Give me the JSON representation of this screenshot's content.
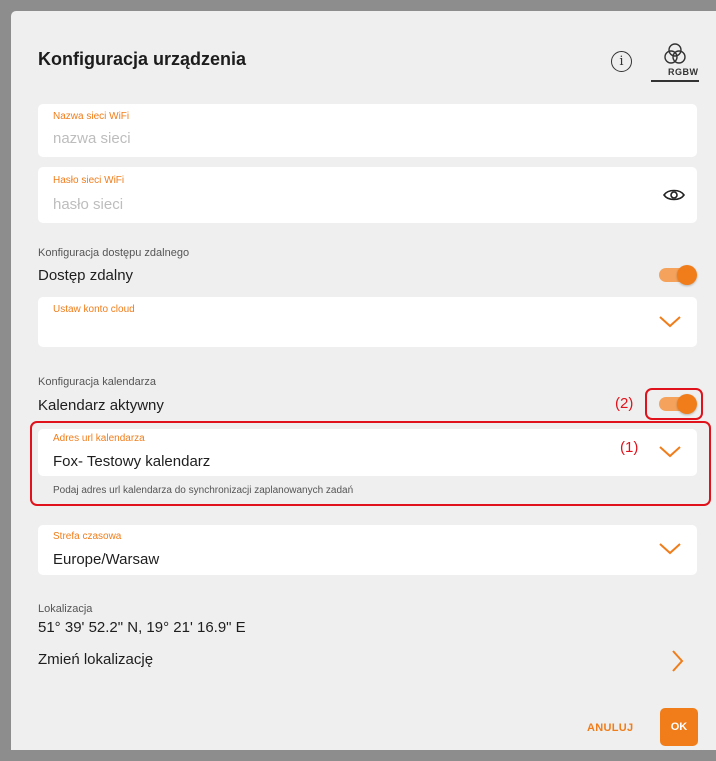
{
  "header": {
    "title": "Konfiguracja urządzenia",
    "info_icon_glyph": "i",
    "mode_label": "RGBW"
  },
  "wifi": {
    "network": {
      "label": "Nazwa sieci WiFi",
      "placeholder": "nazwa sieci"
    },
    "password": {
      "label": "Hasło sieci WiFi",
      "placeholder": "hasło sieci"
    }
  },
  "remote": {
    "caption": "Konfiguracja dostępu zdalnego",
    "title": "Dostęp zdalny",
    "enabled": true,
    "cloud_account": {
      "label": "Ustaw konto cloud",
      "value": ""
    }
  },
  "calendar": {
    "caption": "Konfiguracja kalendarza",
    "title": "Kalendarz aktywny",
    "enabled": true,
    "url": {
      "label": "Adres url kalendarza",
      "value": "Fox- Testowy kalendarz"
    },
    "hint": "Podaj adres url kalendarza do synchronizacji zaplanowanych zadań"
  },
  "annotations": {
    "one": "(1)",
    "two": "(2)"
  },
  "timezone": {
    "label": "Strefa czasowa",
    "value": "Europe/Warsaw"
  },
  "location": {
    "caption": "Lokalizacja",
    "coordinates": "51° 39' 52.2\" N, 19° 21' 16.9\" E",
    "change_label": "Zmień lokalizację"
  },
  "footer": {
    "cancel_label": "ANULUJ",
    "ok_label": "OK"
  },
  "colors": {
    "accent": "#f07d1a",
    "annotation": "#e0121b",
    "background": "#efefef"
  }
}
